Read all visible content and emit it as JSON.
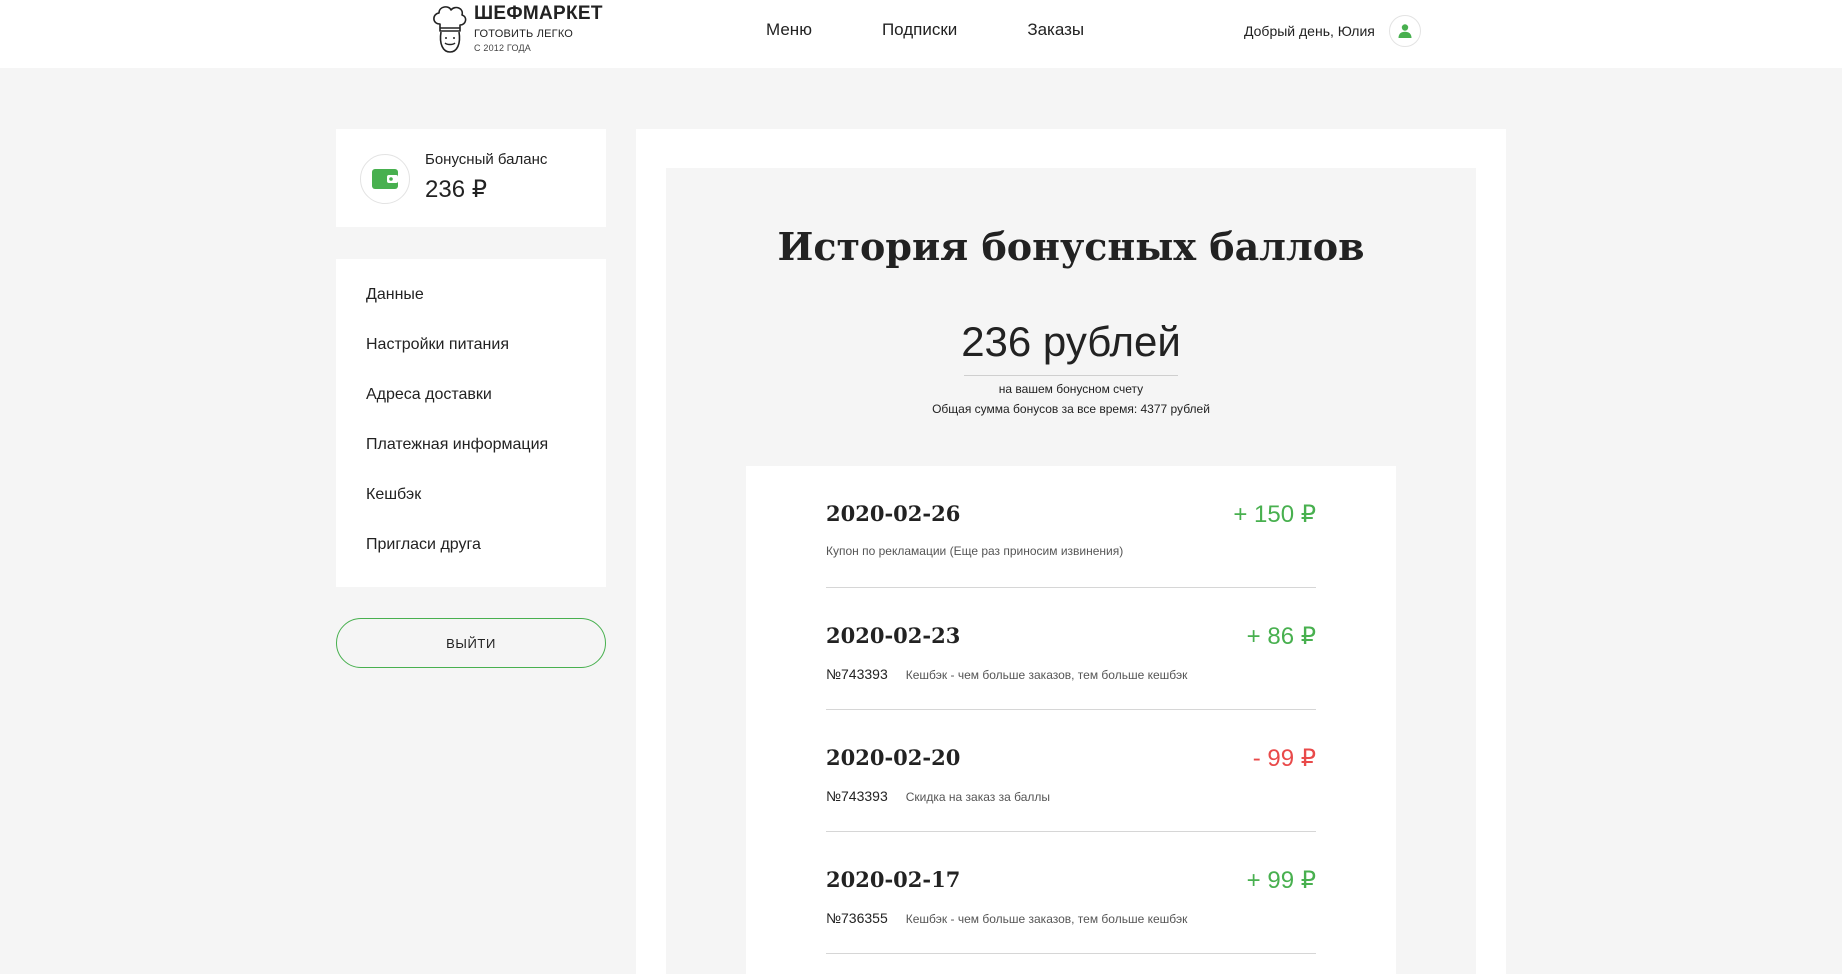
{
  "header": {
    "logo": {
      "name": "ШЕФМАРКЕТ",
      "tagline": "ГОТОВИТЬ ЛЕГКО",
      "since": "С 2012 ГОДА"
    },
    "nav": [
      {
        "label": "Меню"
      },
      {
        "label": "Подписки"
      },
      {
        "label": "Заказы"
      }
    ],
    "greeting": "Добрый день, Юлия",
    "avatar_icon": "user-icon"
  },
  "sidebar": {
    "balance": {
      "icon": "wallet-icon",
      "label": "Бонусный баланс",
      "value": "236 ₽"
    },
    "menu": [
      {
        "label": "Данные"
      },
      {
        "label": "Настройки питания"
      },
      {
        "label": "Адреса доставки"
      },
      {
        "label": "Платежная информация"
      },
      {
        "label": "Кешбэк"
      },
      {
        "label": "Пригласи друга"
      }
    ],
    "logout_label": "выйти"
  },
  "main": {
    "title": "История бонусных баллов",
    "sum": "236 рублей",
    "sum_caption": "на вашем бонусном счету",
    "total_caption": "Общая сумма бонусов за все время: 4377 рублей",
    "transactions": [
      {
        "date": "2020-02-26",
        "amount": "+ 150 ₽",
        "type": "plus",
        "order": "",
        "description": "Купон по рекламации (Еще раз приносим извинения)"
      },
      {
        "date": "2020-02-23",
        "amount": "+ 86 ₽",
        "type": "plus",
        "order": "№743393",
        "description": "Кешбэк - чем больше заказов, тем больше кешбэк"
      },
      {
        "date": "2020-02-20",
        "amount": "- 99 ₽",
        "type": "minus",
        "order": "№743393",
        "description": "Скидка на заказ за баллы"
      },
      {
        "date": "2020-02-17",
        "amount": "+ 99 ₽",
        "type": "plus",
        "order": "№736355",
        "description": "Кешбэк - чем больше заказов, тем больше кешбэк"
      }
    ]
  },
  "colors": {
    "accent_green": "#48b04f",
    "negative_red": "#e94a4a",
    "page_bg": "#f5f5f5",
    "card_bg": "#ffffff"
  }
}
